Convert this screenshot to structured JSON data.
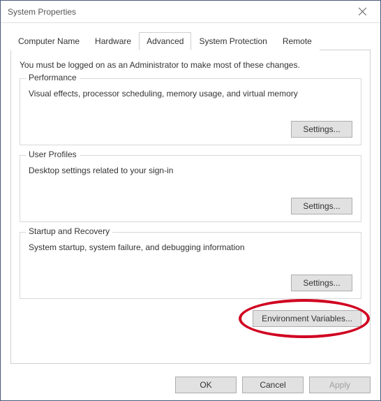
{
  "window": {
    "title": "System Properties"
  },
  "tabs": {
    "computer_name": "Computer Name",
    "hardware": "Hardware",
    "advanced": "Advanced",
    "system_protection": "System Protection",
    "remote": "Remote"
  },
  "intro": "You must be logged on as an Administrator to make most of these changes.",
  "performance": {
    "title": "Performance",
    "desc": "Visual effects, processor scheduling, memory usage, and virtual memory",
    "button": "Settings..."
  },
  "user_profiles": {
    "title": "User Profiles",
    "desc": "Desktop settings related to your sign-in",
    "button": "Settings..."
  },
  "startup_recovery": {
    "title": "Startup and Recovery",
    "desc": "System startup, system failure, and debugging information",
    "button": "Settings..."
  },
  "env_button": "Environment Variables...",
  "footer": {
    "ok": "OK",
    "cancel": "Cancel",
    "apply": "Apply"
  }
}
